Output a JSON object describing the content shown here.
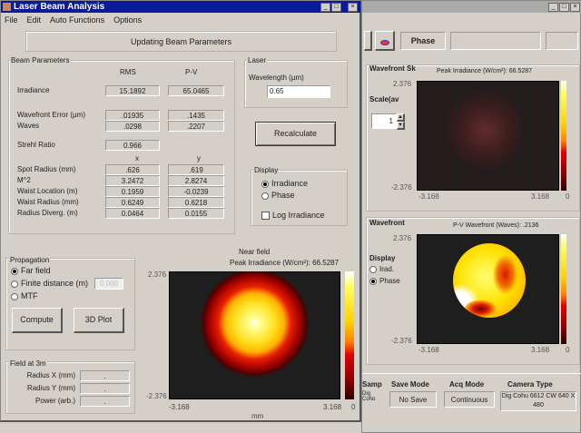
{
  "main_window": {
    "title": "Laser Beam Analysis",
    "menu": [
      "File",
      "Edit",
      "Auto Functions",
      "Options"
    ],
    "status": "Updating Beam Parameters",
    "beam_parameters": {
      "label": "Beam Parameters",
      "col_headers": [
        "RMS",
        "P-V"
      ],
      "xy_headers": [
        "x",
        "y"
      ],
      "rows": [
        {
          "label": "Irradiance",
          "v1": "15.1892",
          "v2": "65.0465"
        },
        {
          "label": "Wavefront Error (µm)",
          "v1": ".01935",
          "v2": ".1435"
        },
        {
          "label": "Waves",
          "v1": ".0298",
          "v2": ".2207"
        },
        {
          "label": "Strehl Ratio",
          "v1": "0.966",
          "v2": ""
        },
        {
          "label": "Spot Radius (mm)",
          "v1": ".626",
          "v2": ".619"
        },
        {
          "label": "M^2",
          "v1": "3.2472",
          "v2": "2.8274"
        },
        {
          "label": "Waist Location (m)",
          "v1": "0.1959",
          "v2": "-0.0239"
        },
        {
          "label": "Waist Radius (mm)",
          "v1": "0.6249",
          "v2": "0.6218"
        },
        {
          "label": "Radius Diverg. (m)",
          "v1": "0.0464",
          "v2": "0.0155"
        }
      ]
    },
    "laser": {
      "label": "Laser",
      "wavelength_label": "Wavelength (µm)",
      "wavelength_value": "0.65"
    },
    "recalculate": "Recalculate",
    "display": {
      "label": "Display",
      "options": [
        "Irradiance",
        "Phase"
      ],
      "selected": "Irradiance",
      "log_label": "Log Irradiance",
      "log_checked": false
    },
    "propagation": {
      "label": "Propagation",
      "options": [
        "Far field",
        "Finite distance (m)",
        "MTF"
      ],
      "selected": "Far field",
      "distance_value": "0.000",
      "compute": "Compute",
      "plot3d": "3D Plot"
    },
    "field": {
      "label": "Field at 3m",
      "rows": [
        {
          "label": "Radius X (mm)",
          "value": "."
        },
        {
          "label": "Radius Y (mm)",
          "value": "."
        },
        {
          "label": "Power (arb.)",
          "value": "."
        }
      ]
    },
    "nearfield": {
      "title": "Near field",
      "peak": "Peak Irradiance (W/cm²): 66.5287",
      "y_top": "2.376",
      "y_bottom": "-2.376",
      "x_left": "-3.168",
      "x_right": "3.168",
      "cbar_min": "0",
      "xlabel": "mm"
    }
  },
  "second_window": {
    "toolbar_label": "Phase",
    "sk": {
      "label": "Wavefront Sk",
      "peak": "Peak Irradiance (W/cm²): 66.5287",
      "scale_label": "Scale(av",
      "scale_value": "1",
      "y_top": "2.376",
      "y_bottom": "-2.376",
      "x_left": "-3.168",
      "x_right": "3.168",
      "cbar_min": "0"
    },
    "wavefront": {
      "label": "Wavefront",
      "pv": "P-V Wavefront (Waves): .2136",
      "display_label": "Display",
      "options": [
        "Irad.",
        "Phase"
      ],
      "selected": "Phase",
      "y_top": "2.376",
      "y_bottom": "-2.376",
      "x_left": "-3.168",
      "x_right": "3.168",
      "cbar_min": "0"
    },
    "status": [
      {
        "header": "Samp",
        "value": "Dig Coho"
      },
      {
        "header": "Save Mode",
        "value": "No Save"
      },
      {
        "header": "Acq Mode",
        "value": "Continuous"
      },
      {
        "header": "Camera Type",
        "value": "Dig Cohu 6612 CW 640 X 480"
      }
    ]
  }
}
